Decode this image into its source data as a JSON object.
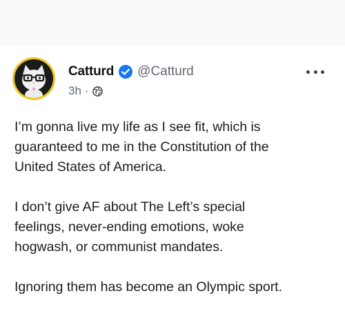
{
  "post": {
    "author": {
      "display_name": "Catturd",
      "handle": "@Catturd",
      "verified": true
    },
    "meta": {
      "time": "3h",
      "separator": "·",
      "audience_icon": "globe-icon"
    },
    "menu_icon": "more-icon",
    "paragraphs": [
      {
        "lines": [
          "I’m gonna live my life as I see fit, which is",
          "guaranteed to me in the Constitution of the",
          "United States of America."
        ]
      },
      {
        "lines": [
          "I don’t give AF about The Left’s special",
          "feelings, never-ending emotions, woke",
          "hogwash, or communist mandates."
        ]
      },
      {
        "lines": [
          "Ignoring them has become an Olympic sport."
        ]
      }
    ]
  },
  "colors": {
    "verified_badge": "#1877f2",
    "avatar_ring": "#f3c61f",
    "secondary_text": "#606770",
    "top_band": "#f8f9fa"
  }
}
